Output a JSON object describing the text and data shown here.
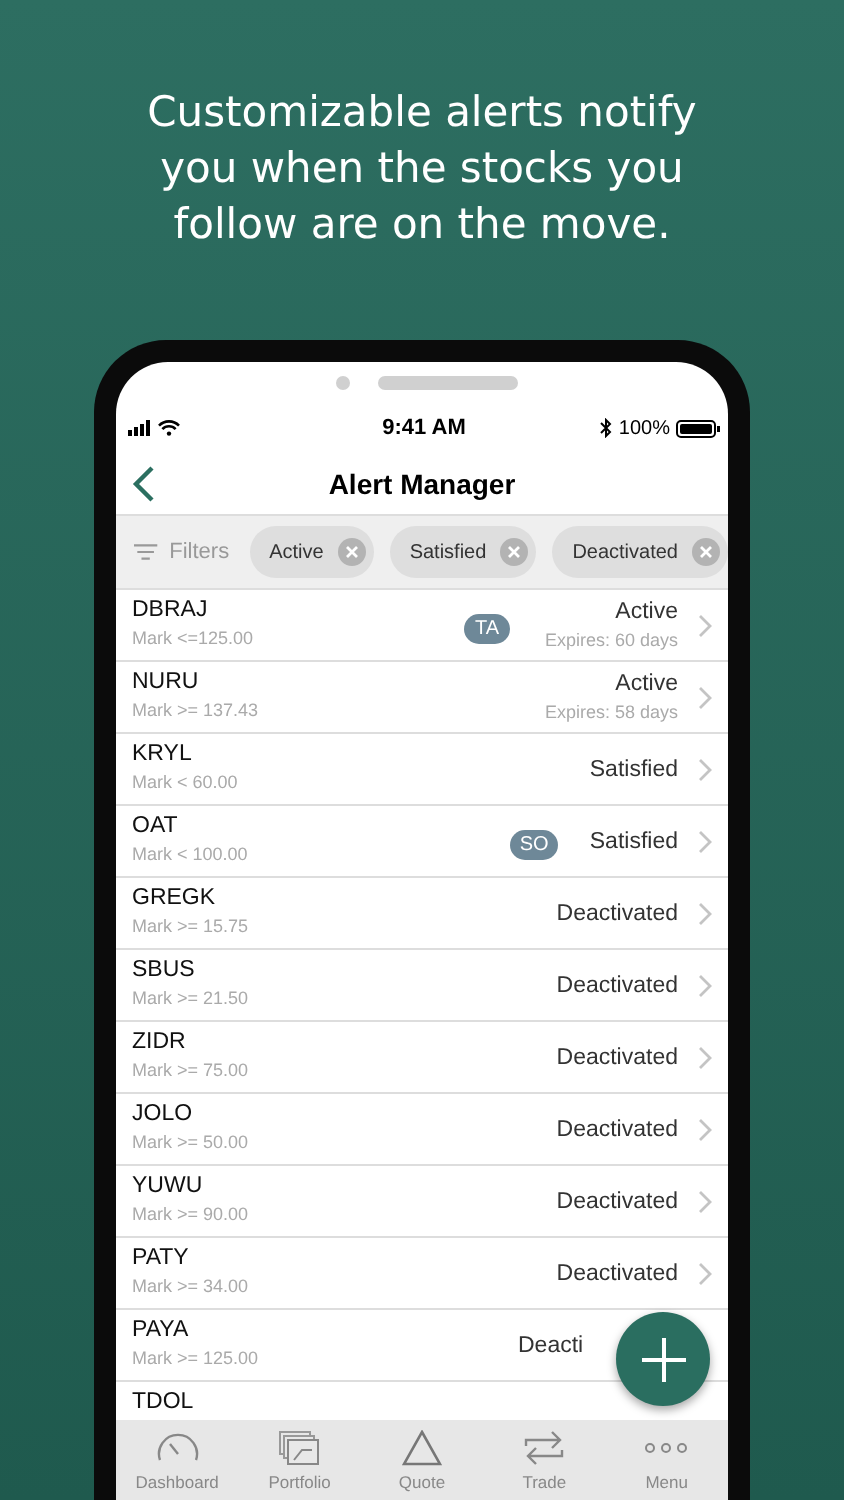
{
  "headline": "Customizable alerts notify you when the stocks you follow are on the move.",
  "status_bar": {
    "time": "9:41 AM",
    "battery": "100%"
  },
  "nav": {
    "title": "Alert Manager"
  },
  "filters": {
    "label": "Filters",
    "chips": [
      {
        "label": "Active"
      },
      {
        "label": "Satisfied"
      },
      {
        "label": "Deactivated"
      }
    ]
  },
  "alerts": [
    {
      "symbol": "DBRAJ",
      "condition": "Mark <=125.00",
      "badge": "TA",
      "status": "Active",
      "expires": "Expires: 60 days"
    },
    {
      "symbol": "NURU",
      "condition": "Mark >= 137.43",
      "status": "Active",
      "expires": "Expires: 58 days"
    },
    {
      "symbol": "KRYL",
      "condition": "Mark < 60.00",
      "status": "Satisfied"
    },
    {
      "symbol": "OAT",
      "condition": "Mark < 100.00",
      "badge": "SO",
      "status": "Satisfied"
    },
    {
      "symbol": "GREGK",
      "condition": "Mark >= 15.75",
      "status": "Deactivated"
    },
    {
      "symbol": "SBUS",
      "condition": "Mark >= 21.50",
      "status": "Deactivated"
    },
    {
      "symbol": "ZIDR",
      "condition": "Mark >= 75.00",
      "status": "Deactivated"
    },
    {
      "symbol": "JOLO",
      "condition": "Mark >= 50.00",
      "status": "Deactivated"
    },
    {
      "symbol": "YUWU",
      "condition": "Mark >= 90.00",
      "status": "Deactivated"
    },
    {
      "symbol": "PATY",
      "condition": "Mark >= 34.00",
      "status": "Deactivated"
    },
    {
      "symbol": "PAYA",
      "condition": "Mark >= 125.00",
      "status": "Deacti",
      "under_button": true
    },
    {
      "symbol": "TDOL"
    }
  ],
  "tabs": [
    {
      "kind": "gauge",
      "label": "Dashboard"
    },
    {
      "kind": "cards",
      "label": "Portfolio"
    },
    {
      "kind": "triangle",
      "label": "Quote"
    },
    {
      "kind": "arrows",
      "label": "Trade"
    },
    {
      "kind": "dots",
      "label": "Menu"
    }
  ]
}
